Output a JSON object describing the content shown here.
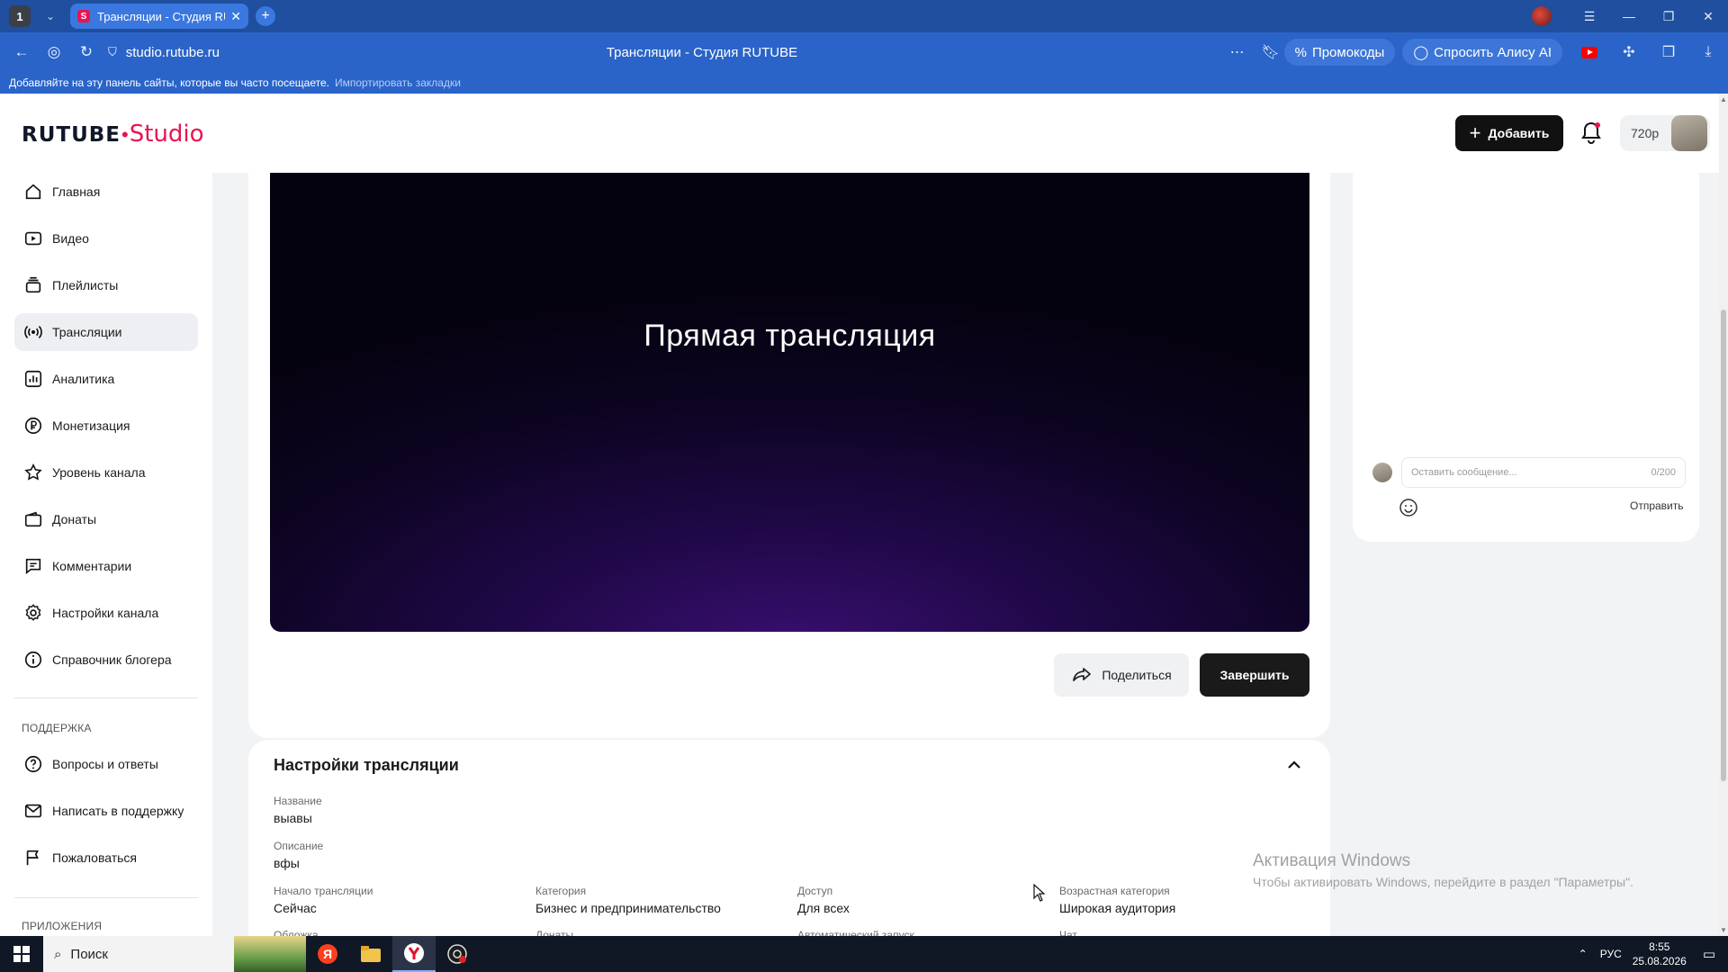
{
  "browser": {
    "tab_count": "1",
    "tab_title": "Трансляции - Студия RUTUBE",
    "url": "studio.rutube.ru",
    "page_title": "Трансляции - Студия RUTUBE",
    "promo_label": "Промокоды",
    "alice_label": "Спросить Алису AI",
    "bookmarks_hint": "Добавляйте на эту панель сайты, которые вы часто посещаете.",
    "bookmarks_import": "Импортировать закладки"
  },
  "header": {
    "logo_main": "RUTUBE",
    "logo_studio": "Studio",
    "add_label": "Добавить",
    "resolution": "720p"
  },
  "sidebar": {
    "items": [
      {
        "label": "Главная",
        "icon": "home-icon"
      },
      {
        "label": "Видео",
        "icon": "video-icon"
      },
      {
        "label": "Плейлисты",
        "icon": "playlist-icon"
      },
      {
        "label": "Трансляции",
        "icon": "broadcast-icon"
      },
      {
        "label": "Аналитика",
        "icon": "analytics-icon"
      },
      {
        "label": "Монетизация",
        "icon": "ruble-icon"
      },
      {
        "label": "Уровень канала",
        "icon": "star-icon"
      },
      {
        "label": "Донаты",
        "icon": "wallet-icon"
      },
      {
        "label": "Комментарии",
        "icon": "comment-icon"
      },
      {
        "label": "Настройки канала",
        "icon": "gear-icon"
      },
      {
        "label": "Справочник блогера",
        "icon": "info-icon"
      }
    ],
    "support_heading": "ПОДДЕРЖКА",
    "support_items": [
      {
        "label": "Вопросы и ответы",
        "icon": "question-icon"
      },
      {
        "label": "Написать в поддержку",
        "icon": "mail-icon"
      },
      {
        "label": "Пожаловаться",
        "icon": "flag-icon"
      }
    ],
    "apps_heading": "ПРИЛОЖЕНИЯ"
  },
  "player": {
    "title": "Прямая трансляция",
    "share_label": "Поделиться",
    "end_label": "Завершить"
  },
  "chat": {
    "placeholder": "Оставить сообщение...",
    "counter": "0/200",
    "send_label": "Отправить"
  },
  "settings": {
    "heading": "Настройки трансляции",
    "name_label": "Название",
    "name_value": "выавы",
    "desc_label": "Описание",
    "desc_value": "вфы",
    "start_label": "Начало трансляции",
    "start_value": "Сейчас",
    "category_label": "Категория",
    "category_value": "Бизнес и предпринимательство",
    "access_label": "Доступ",
    "access_value": "Для всех",
    "age_label": "Возрастная категория",
    "age_value": "Широкая аудитория",
    "cut_row": [
      "Обложка",
      "Донаты",
      "Автоматический запуск",
      "Чат"
    ]
  },
  "watermark": {
    "line1": "Активация Windows",
    "line2": "Чтобы активировать Windows, перейдите в раздел \"Параметры\"."
  },
  "taskbar": {
    "search": "Поиск",
    "lang": "РУС",
    "time": "8:55",
    "date": "25.08.2026"
  },
  "colors": {
    "accent": "#e9144f",
    "browser_chrome": "#2a64c8",
    "dark_button": "#111111"
  }
}
